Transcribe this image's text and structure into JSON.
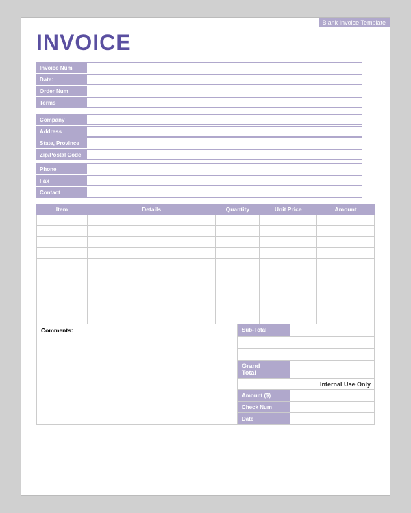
{
  "template_label": "Blank Invoice Template",
  "title": "INVOICE",
  "invoice_info": {
    "fields": [
      {
        "label": "Invoice Num",
        "value": ""
      },
      {
        "label": "Date:",
        "value": ""
      },
      {
        "label": "Order Num",
        "value": ""
      },
      {
        "label": "Terms",
        "value": ""
      }
    ]
  },
  "company_info": {
    "fields": [
      {
        "label": "Company",
        "value": ""
      },
      {
        "label": "Address",
        "value": ""
      },
      {
        "label": "State, Province",
        "value": ""
      },
      {
        "label": "Zip/Postal Code",
        "value": ""
      }
    ]
  },
  "contact_info": {
    "fields": [
      {
        "label": "Phone",
        "value": ""
      },
      {
        "label": "Fax",
        "value": ""
      },
      {
        "label": "Contact",
        "value": ""
      }
    ]
  },
  "table": {
    "headers": [
      "Item",
      "Details",
      "Quantity",
      "Unit Price",
      "Amount"
    ],
    "rows": 10
  },
  "comments_label": "Comments:",
  "totals": {
    "subtotal_label": "Sub-Total",
    "rows": [
      {
        "label": "Sub-Total",
        "value": ""
      },
      {
        "label": "",
        "value": ""
      },
      {
        "label": "",
        "value": ""
      },
      {
        "label": "Grand\nTotal",
        "value": ""
      }
    ]
  },
  "internal_use": "Internal Use Only",
  "payment": {
    "fields": [
      {
        "label": "Amount ($)",
        "value": ""
      },
      {
        "label": "Check Num",
        "value": ""
      },
      {
        "label": "Date",
        "value": ""
      }
    ]
  }
}
